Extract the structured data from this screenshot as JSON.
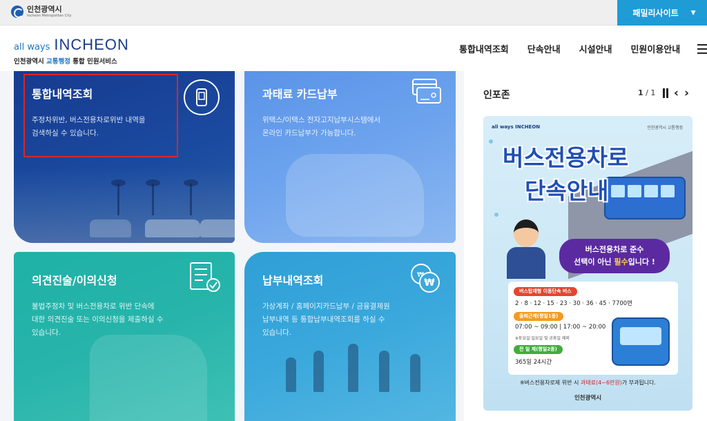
{
  "topbar": {
    "city_name": "인천광역시",
    "city_sub": "Incheon Metropolitan City",
    "family_site": "패밀리사이트",
    "family_icon": "chevron-down-icon"
  },
  "header": {
    "brand_allways": "all ways",
    "brand_logo_text": "INCHEON",
    "brand_sub_prefix": "인천광역시 ",
    "brand_sub_highlight": "교통행정",
    "brand_sub_suffix": " 통합 민원서비스",
    "nav": [
      "통합내역조회",
      "단속안내",
      "시설안내",
      "민원이용안내"
    ],
    "menu_icon": "hamburger-menu-icon"
  },
  "cards": [
    {
      "title": "통합내역조회",
      "desc_line1": "주정차위반, 버스전용차로위반 내역을",
      "desc_line2": "검색하실 수 있습니다.",
      "icon": "smartphone-icon",
      "color": "#173b8f"
    },
    {
      "title": "과태료 카드납부",
      "desc_line1": "위택스/이택스 전자고지납부시스템에서",
      "desc_line2": "온라인 카드납부가 가능합니다.",
      "icon": "credit-card-icon",
      "color": "#5a93e8"
    },
    {
      "title": "의견진술/이의신청",
      "desc_line1": "불법주정차 및 버스전용차로 위반 단속에",
      "desc_line2": "대한 의견진술 또는 이의신청을 제출하실 수",
      "desc_line3": "있습니다.",
      "icon": "checklist-icon",
      "color": "#1fb1a6"
    },
    {
      "title": "납부내역조회",
      "desc_line1": "가상계좌 / 홈페이지카드납부 / 금융결제원",
      "desc_line2": "납부내역 등 통합납부내역조회를 하실 수",
      "desc_line3": "있습니다.",
      "icon": "won-coin-icon",
      "color": "#2f9fd6"
    }
  ],
  "infozone": {
    "title": "인포존",
    "page_current": "1",
    "page_total": "/ 1",
    "pause_icon": "pause-icon",
    "prev_icon": "chevron-left-icon",
    "next_icon": "chevron-right-icon",
    "poster": {
      "logo": "all ways INCHEON",
      "logo_right": "인천광역시 교통행정",
      "title_line1": "버스전용차로",
      "title_line2": "단속안내",
      "bubble_line1": "버스전용차로 준수",
      "bubble_line2_a": "선택이 아닌 ",
      "bubble_line2_b": "필수",
      "bubble_line2_c": "입니다 !",
      "tag1": "버스탑재형 이동단속 버스",
      "routes": "2 · 8 · 12 · 15 · 23 · 30 · 36 · 45 · 7700번",
      "tag2": "출퇴근제(평일1종)",
      "hours": "07:00 ~ 09:00  |  17:00 ~ 20:00",
      "hours_note": "※토요일·일요일 및 공휴일 제외",
      "tag3": "전 일 제(평일2종)",
      "allday": "365일 24시간",
      "note_a": "※버스전용차로제 위반 시 ",
      "note_b": "과태료(4~6만원)",
      "note_c": "가 부과됩니다.",
      "footer": "인천광역시",
      "title_color": "#1f4fb4",
      "bubble_color": "#5b2aa0"
    }
  }
}
